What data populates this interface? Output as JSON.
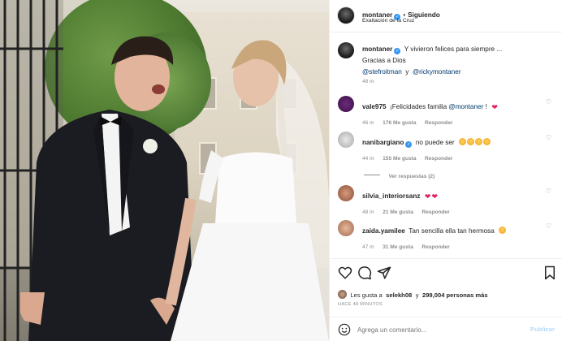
{
  "post": {
    "username": "montaner",
    "follow_status": "Siguiendo",
    "location": "Exaltación de la Cruz",
    "caption_username": "montaner",
    "caption_text": "Y vivieron felices para siempre ...",
    "caption_line2": "Gracias a Dios",
    "mention1": "@stefroitman",
    "mention_joiner": "y",
    "mention2": "@rickymontaner",
    "caption_time": "48 m"
  },
  "comments": [
    {
      "username": "vale975",
      "text_prefix": "¡Felicidades familia ",
      "mention": "@montaner",
      "text_suffix": " !",
      "time": "46 m",
      "likes": "176 Me gusta",
      "reply": "Responder"
    },
    {
      "username": "nanibargiano",
      "text": "no puede ser",
      "time": "44 m",
      "likes": "155 Me gusta",
      "reply": "Responder",
      "view_replies": "Ver respuestas (2)"
    },
    {
      "username": "silvia_interiorsanz",
      "text": "",
      "time": "48 m",
      "likes": "21 Me gusta",
      "reply": "Responder"
    },
    {
      "username": "zaida.yamilee",
      "text": "Tan sencilla ella tan hermosa",
      "time": "47 m",
      "likes": "31 Me gusta",
      "reply": "Responder"
    }
  ],
  "likes_bar": {
    "prefix": "Les gusta a",
    "user": "selekh08",
    "joiner": "y",
    "count": "299,004 personas más",
    "time_ago": "HACE 48 MINUTOS"
  },
  "add_comment": {
    "placeholder": "Agrega un comentario...",
    "publish": "Publicar"
  },
  "colors": {
    "verified": "#3897f0",
    "link": "#00376b",
    "heart": "#e0245e",
    "muted": "#8e8e8e"
  },
  "icons": [
    "more-icon",
    "heart-icon",
    "comment-icon",
    "share-icon",
    "emoji-icon",
    "verified-icon"
  ]
}
